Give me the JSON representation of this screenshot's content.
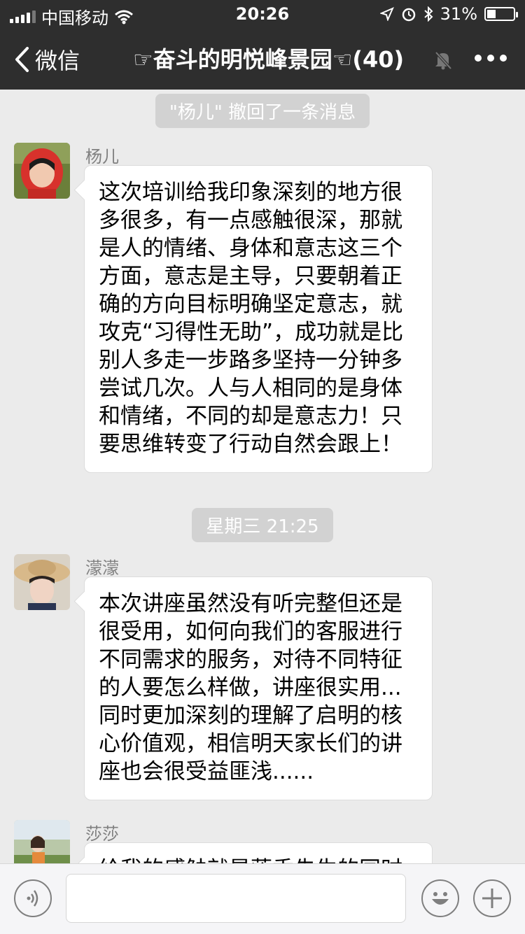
{
  "status_bar": {
    "carrier": "中国移动",
    "time": "20:26",
    "battery": "31%"
  },
  "nav": {
    "back_label": "微信",
    "title": "☞奋斗的明悦峰景园☜(40)"
  },
  "chat": {
    "recall_notice": "\"杨儿\" 撤回了一条消息",
    "timestamp": "星期三 21:25",
    "messages": [
      {
        "sender": "杨儿",
        "lines": [
          "这次培训给我印象深刻的地方很",
          "多很多，有一点感触很深，那就",
          "是人的情绪、身体和意志这三个",
          "方面，意志是主导，只要朝着正",
          "确的方向目标明确坚定意志，就",
          "攻克“习得性无助”，成功就是比",
          "别人多走一步路多坚持一分钟多",
          "尝试几次。人与人相同的是身体",
          "和情绪，不同的却是意志力！只",
          "要思维转变了行动自然会跟上！"
        ]
      },
      {
        "sender": "濛濛",
        "lines": [
          "本次讲座虽然没有听完整但还是",
          "很受用，如何向我们的客服进行",
          "不同需求的服务，对待不同特征",
          "的人要怎么样做，讲座很实用...",
          "同时更加深刻的理解了启明的核",
          "心价值观，相信明天家长们的讲",
          "座也会很受益匪浅......"
        ]
      },
      {
        "sender": "莎莎",
        "lines": [
          "给我的感触就是莲香先生的同时"
        ]
      }
    ]
  },
  "input_bar": {
    "voice_icon": "voice-icon",
    "emoji_icon": "emoji-icon",
    "plus_icon": "plus-icon"
  }
}
